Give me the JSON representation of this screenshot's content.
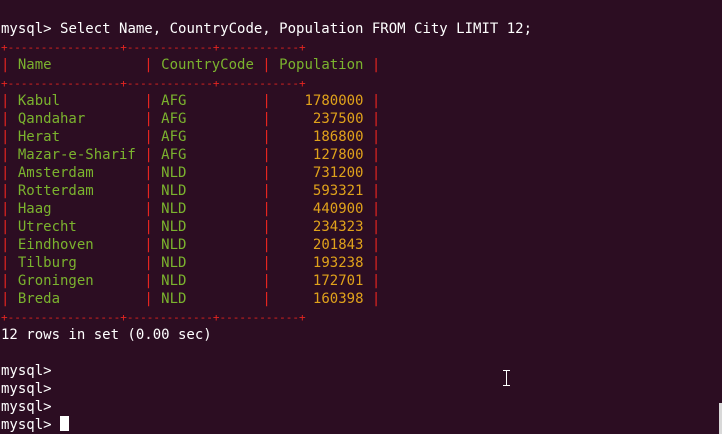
{
  "query": {
    "prompt": "mysql> ",
    "text": "Select Name, CountryCode, Population FROM City LIMIT 12;"
  },
  "table": {
    "border_line": "+-----------------+-------------+------------+",
    "columns": [
      "Name",
      "CountryCode",
      "Population"
    ],
    "rows": [
      {
        "name": "Kabul",
        "code": "AFG",
        "population": "1780000"
      },
      {
        "name": "Qandahar",
        "code": "AFG",
        "population": "237500"
      },
      {
        "name": "Herat",
        "code": "AFG",
        "population": "186800"
      },
      {
        "name": "Mazar-e-Sharif",
        "code": "AFG",
        "population": "127800"
      },
      {
        "name": "Amsterdam",
        "code": "NLD",
        "population": "731200"
      },
      {
        "name": "Rotterdam",
        "code": "NLD",
        "population": "593321"
      },
      {
        "name": "Haag",
        "code": "NLD",
        "population": "440900"
      },
      {
        "name": "Utrecht",
        "code": "NLD",
        "population": "234323"
      },
      {
        "name": "Eindhoven",
        "code": "NLD",
        "population": "201843"
      },
      {
        "name": "Tilburg",
        "code": "NLD",
        "population": "193238"
      },
      {
        "name": "Groningen",
        "code": "NLD",
        "population": "172701"
      },
      {
        "name": "Breda",
        "code": "NLD",
        "population": "160398"
      }
    ]
  },
  "result_summary": "12 rows in set (0.00 sec)",
  "prompts": [
    "mysql>",
    "mysql>",
    "mysql>",
    "mysql>"
  ],
  "colors": {
    "background": "#2c0d22",
    "border": "#e52520",
    "text_cells": "#7bb32e",
    "numeric_cells": "#e0a21b",
    "foreground": "#ffffff"
  },
  "icons": {
    "mouse_cursor": "i-beam-cursor-icon",
    "text_cursor": "block-cursor-icon"
  }
}
